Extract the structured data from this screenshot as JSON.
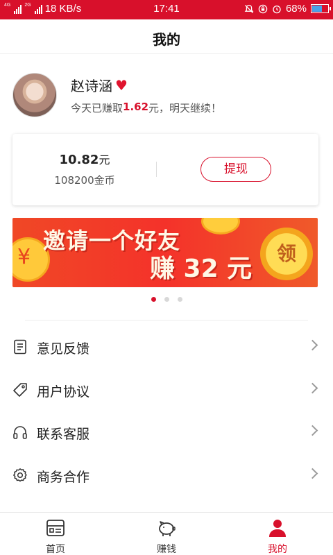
{
  "status_bar": {
    "net_speed": "18 KB/s",
    "time": "17:41",
    "battery": "68%",
    "battery_level": 0.68,
    "net_tags": [
      "4G",
      "2G"
    ]
  },
  "header": {
    "title": "我的"
  },
  "profile": {
    "name": "赵诗涵",
    "earned_prefix": "今天已赚取",
    "earned_amount": "1.62",
    "earned_suffix": "元，明天继续！"
  },
  "wallet": {
    "balance_value": "10.82",
    "balance_unit": "元",
    "coins": "108200金币",
    "withdraw_label": "提现"
  },
  "banner": {
    "line1": "邀请一个好友",
    "line2": "赚 32 元",
    "badge": "领",
    "pagination": {
      "count": 3,
      "active": 0
    }
  },
  "menu": {
    "items": [
      {
        "label": "意见反馈",
        "icon": "document-icon"
      },
      {
        "label": "用户协议",
        "icon": "tag-icon"
      },
      {
        "label": "联系客服",
        "icon": "headphones-icon"
      },
      {
        "label": "商务合作",
        "icon": "gear-icon"
      }
    ]
  },
  "tabs": {
    "items": [
      {
        "label": "首页",
        "icon": "home-icon"
      },
      {
        "label": "赚钱",
        "icon": "piggy-bank-icon"
      },
      {
        "label": "我的",
        "icon": "user-icon"
      }
    ],
    "active": 2
  },
  "colors": {
    "brand": "#d8102b",
    "text": "#222222"
  }
}
